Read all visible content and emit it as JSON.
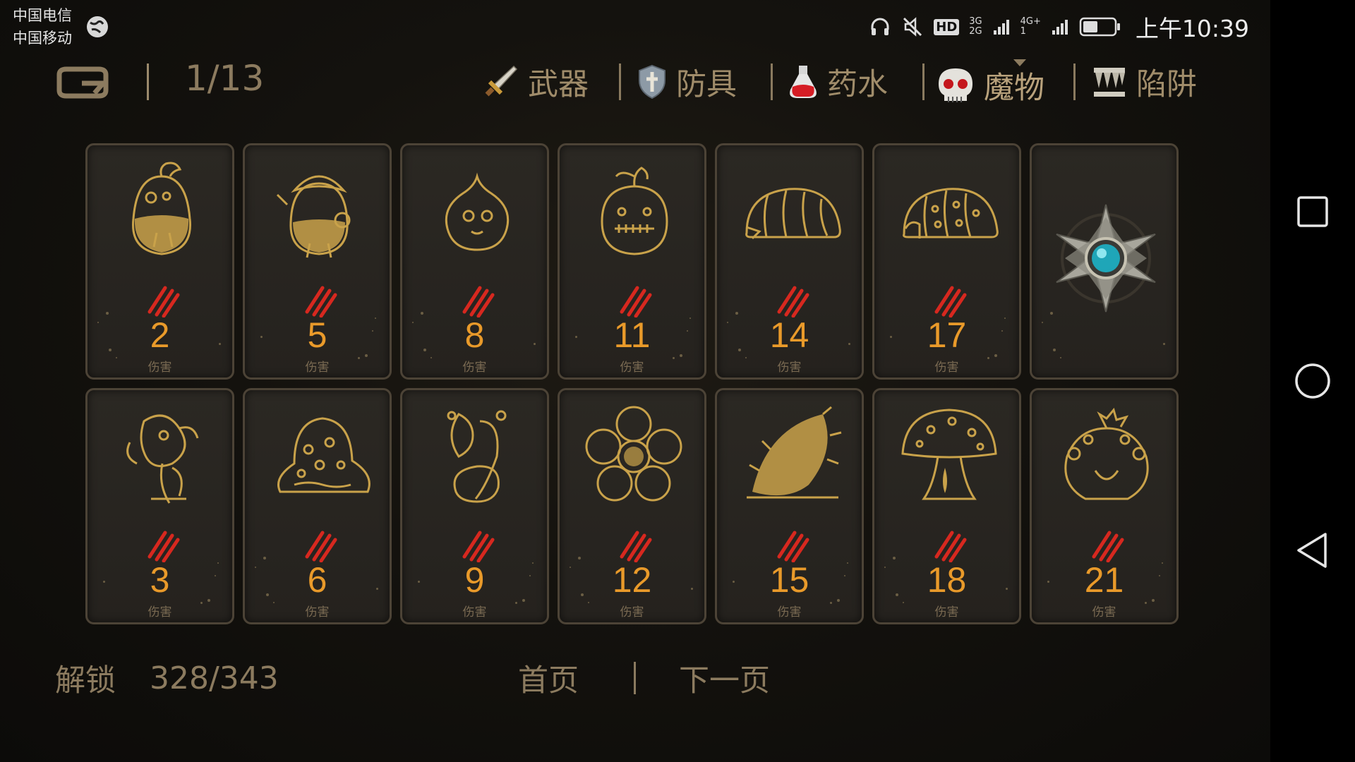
{
  "status_bar": {
    "carrier_1": "中国电信",
    "carrier_2": "中国移动",
    "network_label": "HD",
    "signal_1": "3G",
    "signal_2": "2G",
    "signal_3": "4G+",
    "signal_4": "1",
    "time": "上午10:39"
  },
  "header": {
    "page_indicator": "1/13",
    "tabs": [
      {
        "label": "武器",
        "icon": "sword-icon"
      },
      {
        "label": "防具",
        "icon": "shield-icon"
      },
      {
        "label": "药水",
        "icon": "potion-icon"
      },
      {
        "label": "魔物",
        "icon": "skull-icon",
        "active": true
      },
      {
        "label": "陷阱",
        "icon": "spike-trap-icon"
      }
    ]
  },
  "cards": [
    {
      "value": "2",
      "label": "伤害",
      "art": "pear-monster-icon"
    },
    {
      "value": "5",
      "label": "伤害",
      "art": "armored-pear-monster-icon"
    },
    {
      "value": "8",
      "label": "伤害",
      "art": "slime-icon"
    },
    {
      "value": "11",
      "label": "伤害",
      "art": "stitched-fruit-icon"
    },
    {
      "value": "14",
      "label": "伤害",
      "art": "larva-icon"
    },
    {
      "value": "17",
      "label": "伤害",
      "art": "spotted-larva-icon"
    },
    {
      "value": "",
      "label": "",
      "art": "locked-star-emblem-icon",
      "locked": true
    },
    {
      "value": "3",
      "label": "伤害",
      "art": "jester-plant-icon"
    },
    {
      "value": "6",
      "label": "伤害",
      "art": "blob-monster-icon"
    },
    {
      "value": "9",
      "label": "伤害",
      "art": "flytrap-icon"
    },
    {
      "value": "12",
      "label": "伤害",
      "art": "rafflesia-icon"
    },
    {
      "value": "15",
      "label": "伤害",
      "art": "spiked-pod-icon"
    },
    {
      "value": "18",
      "label": "伤害",
      "art": "mushroom-icon"
    },
    {
      "value": "21",
      "label": "伤害",
      "art": "flower-creature-icon"
    }
  ],
  "footer": {
    "unlock_label": "解锁",
    "unlock_count": "328/343",
    "home_label": "首页",
    "next_label": "下一页"
  },
  "colors": {
    "damage": "#e99a2a",
    "claw": "#d7281f",
    "line_art": "#c9a24a"
  }
}
